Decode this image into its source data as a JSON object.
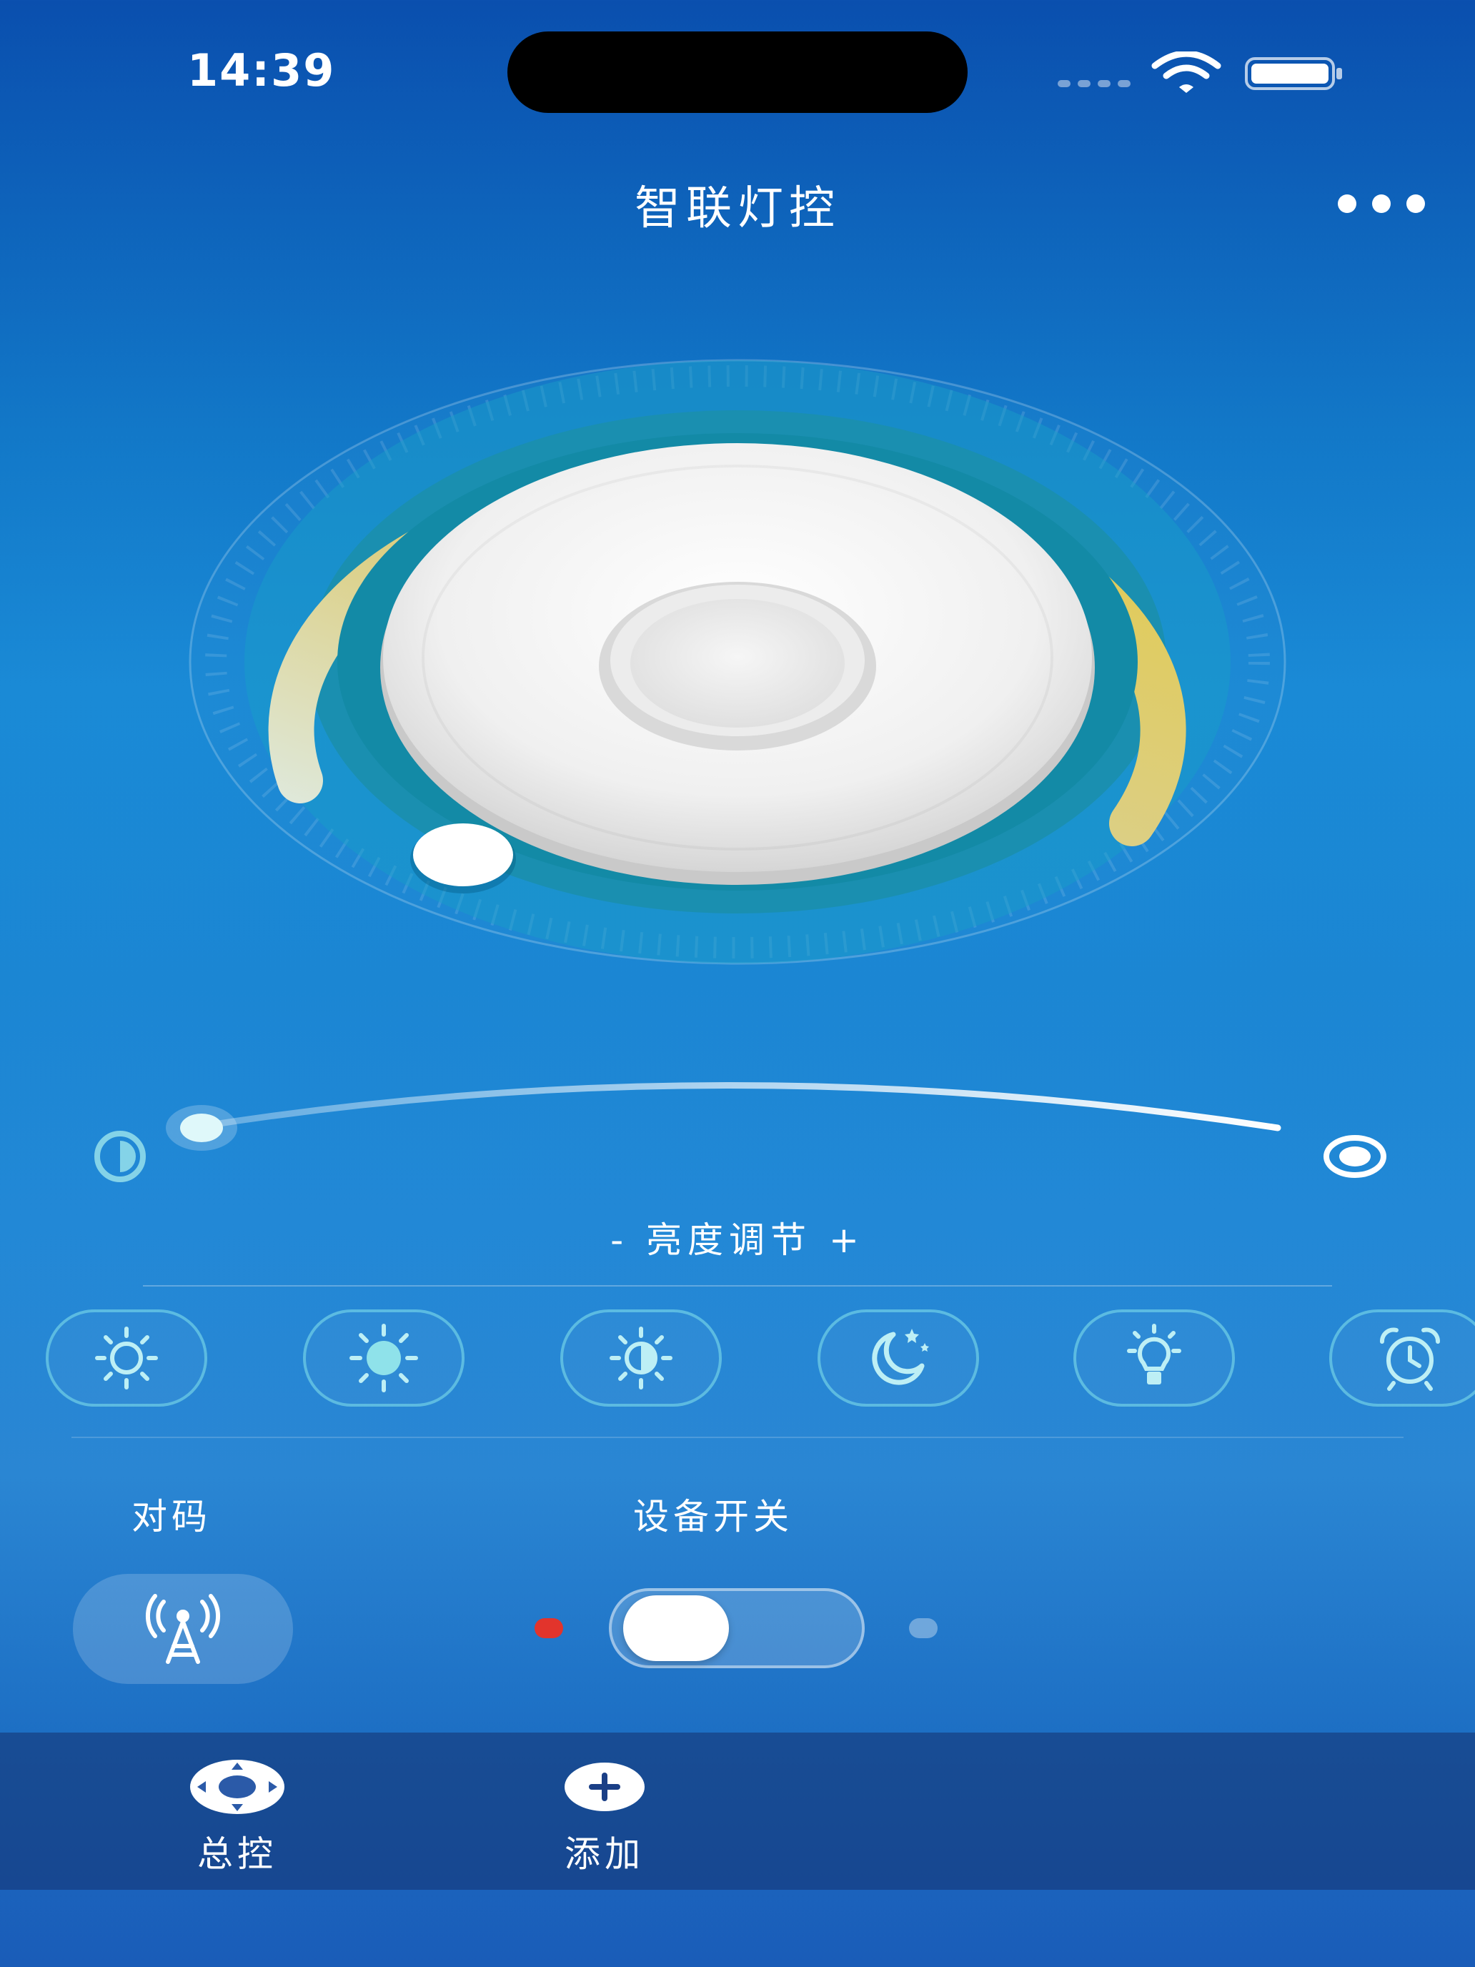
{
  "status_bar": {
    "time": "14:39",
    "icons": [
      "signal-dots-icon",
      "wifi-icon",
      "battery-icon"
    ]
  },
  "header": {
    "title": "智联灯控",
    "menu_icon": "more-horizontal-icon"
  },
  "dial": {
    "arc_color": "#e2c94a",
    "knob_color": "#f2f2f2"
  },
  "brightness": {
    "label": "- 亮度调节 +",
    "min_icon": "half-moon-icon",
    "max_icon": "full-circle-icon"
  },
  "modes": [
    {
      "icon": "sun-outline-icon"
    },
    {
      "icon": "sun-filled-icon"
    },
    {
      "icon": "sun-half-icon"
    },
    {
      "icon": "moon-stars-icon"
    },
    {
      "icon": "bulb-icon"
    },
    {
      "icon": "alarm-clock-icon"
    }
  ],
  "controls": {
    "pair_label": "对码",
    "switch_label": "设备开关",
    "pair_icon": "signal-tower-icon",
    "status_on_color": "#e2342c"
  },
  "nav": {
    "items": [
      {
        "label": "总控",
        "icon": "gamepad-icon"
      },
      {
        "label": "添加",
        "icon": "plus-circle-icon"
      }
    ]
  }
}
